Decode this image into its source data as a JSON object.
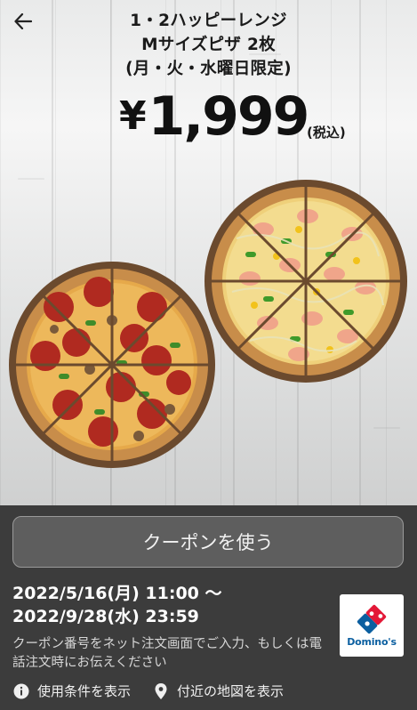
{
  "header": {
    "title_lines": [
      "1・2ハッピーレンジ",
      "Mサイズピザ 2枚",
      "(月・火・水曜日限定)"
    ],
    "back_icon": "arrow-left-icon"
  },
  "price": {
    "currency": "¥",
    "amount": "1,999",
    "tax_note": "(税込)"
  },
  "coupon": {
    "use_button_label": "クーポンを使う",
    "valid_from": "2022/5/16(月) 11:00 〜",
    "valid_to": "2022/9/28(水) 23:59",
    "note": "クーポン番号をネット注文画面でご入力、もしくは電話注文時にお伝えください"
  },
  "brand": {
    "name": "Domino's",
    "logo_icon": "dominos-logo-icon",
    "colors": {
      "blue": "#0b5fa0",
      "red": "#e31837"
    }
  },
  "links": {
    "terms_label": "使用条件を表示",
    "terms_icon": "info-icon",
    "map_label": "付近の地図を表示",
    "map_icon": "location-pin-icon"
  },
  "theme": {
    "panel_bg": "#3c3c3c",
    "button_bg": "#5e5e5e"
  }
}
